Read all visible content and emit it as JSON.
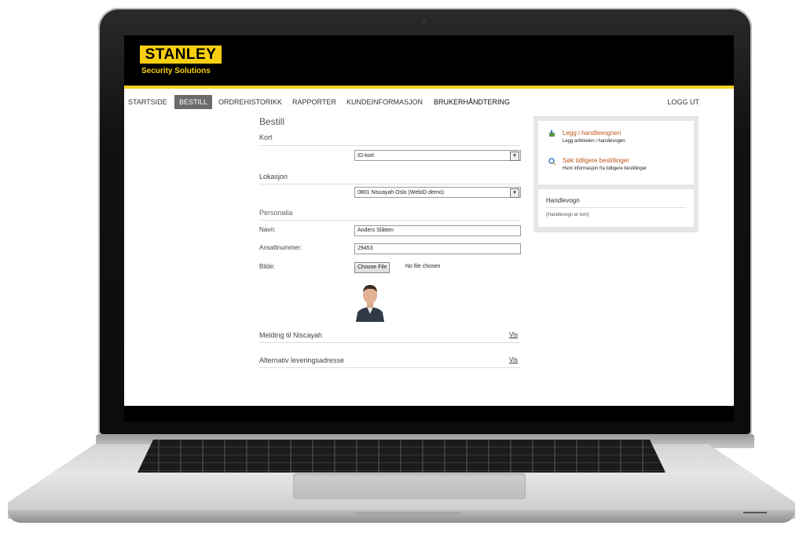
{
  "brand": {
    "logo_text": "STANLEY",
    "logo_subtext": "Security Solutions"
  },
  "nav": {
    "items": [
      "STARTSIDE",
      "BESTILL",
      "ORDREHISTORIKK",
      "RAPPORTER",
      "KUNDEINFORMASJON",
      "BRUKERHÅNDTERING"
    ],
    "active": "BESTILL",
    "logout": "LOGG UT"
  },
  "form": {
    "title": "Bestill",
    "kort_label": "Kort",
    "kort_value": "ID-kort",
    "lokasjon_label": "Lokasjon",
    "lokasjon_value": "0801 Niscayah Oslo (WebID demo)",
    "personalia_label": "Personalia",
    "navn_label": "Navn:",
    "navn_value": "Anders Slåtten",
    "ansatt_label": "Ansattnummer:",
    "ansatt_value": "29453",
    "bilde_label": "Bilde:",
    "choose_file": "Choose File",
    "no_file": "No file chosen",
    "melding_label": "Melding til Niscayah",
    "melding_link": "Vis",
    "alt_label": "Alternativ leveringsadresse",
    "alt_link": "Vis"
  },
  "sidebar": {
    "add_link": "Legg i handlevognen",
    "add_desc": "Legg artikkelen i handlevogen",
    "search_link": "Søk tidligere bestillinger",
    "search_desc": "Hent informasjon fra tidligere bestillinger",
    "cart_title": "Handlevogn",
    "cart_empty": "(Handlevogn er tom)"
  },
  "colors": {
    "accent": "#f8cf10",
    "link": "#c0561b",
    "active_tab": "#6b6b6b"
  },
  "icons": [
    "cart-add-icon",
    "magnifier-icon",
    "select-arrow-icon"
  ]
}
